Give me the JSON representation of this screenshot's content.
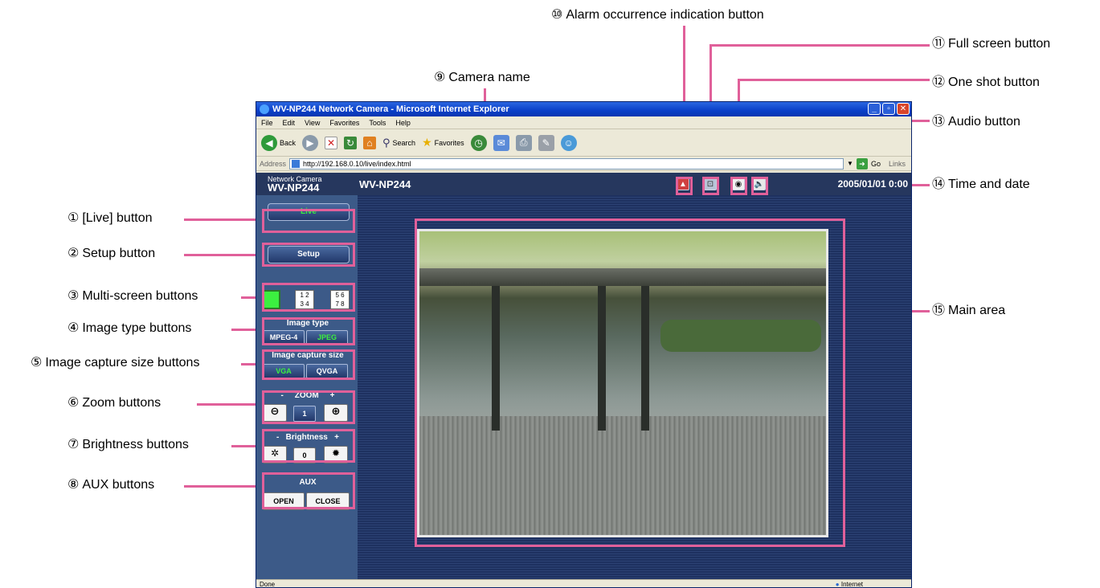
{
  "callouts": {
    "live": {
      "num": "①",
      "text": "[Live] button"
    },
    "setup": {
      "num": "②",
      "text": "Setup button"
    },
    "multiscreen": {
      "num": "③",
      "text": "Multi-screen buttons"
    },
    "imagetype": {
      "num": "④",
      "text": "Image type buttons"
    },
    "capturesize": {
      "num": "⑤",
      "text": "Image capture size buttons"
    },
    "zoom": {
      "num": "⑥",
      "text": "Zoom buttons"
    },
    "brightness": {
      "num": "⑦",
      "text": "Brightness buttons"
    },
    "aux": {
      "num": "⑧",
      "text": "AUX buttons"
    },
    "cameraname": {
      "num": "⑨",
      "text": "Camera name"
    },
    "alarm": {
      "num": "⑩",
      "text": "Alarm occurrence indication button"
    },
    "fullscreen": {
      "num": "⑪",
      "text": "Full screen button"
    },
    "oneshot": {
      "num": "⑫",
      "text": "One shot button"
    },
    "audio": {
      "num": "⑬",
      "text": "Audio button"
    },
    "timedate": {
      "num": "⑭",
      "text": "Time and date"
    },
    "mainarea": {
      "num": "⑮",
      "text": "Main area"
    }
  },
  "browser": {
    "title": "WV-NP244 Network Camera - Microsoft Internet Explorer",
    "menu": [
      "File",
      "Edit",
      "View",
      "Favorites",
      "Tools",
      "Help"
    ],
    "toolbar": {
      "back": "Back",
      "search": "Search",
      "favorites": "Favorites"
    },
    "address_label": "Address",
    "address_value": "http://192.168.0.10/live/index.html",
    "go": "Go",
    "links": "Links",
    "status_left": "Done",
    "status_zone": "Internet"
  },
  "camera": {
    "brand_small": "Network Camera",
    "brand_model": "WV-NP244",
    "name": "WV-NP244",
    "datetime": "2005/01/01  0:00",
    "live_label": "Live",
    "setup_label": "Setup",
    "image_type_title": "Image type",
    "mpeg4": "MPEG-4",
    "jpeg": "JPEG",
    "capture_title": "Image capture size",
    "vga": "VGA",
    "qvga": "QVGA",
    "zoom_title": "-     ZOOM     +",
    "zoom_value": "1",
    "brightness_title": "-   Brightness   +",
    "brightness_value": "0",
    "aux_title": "AUX",
    "open": "OPEN",
    "close": "CLOSE"
  },
  "colors": {
    "annotation": "#e0609a",
    "active_text": "#3cf040",
    "page_bg": "#1e3160"
  }
}
